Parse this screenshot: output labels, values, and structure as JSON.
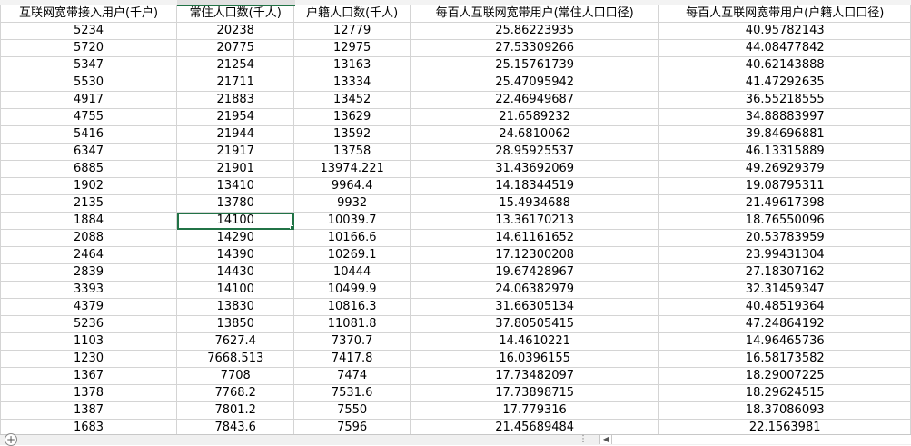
{
  "sheet": {
    "headers": [
      "互联网宽带接入用户(千户)",
      "常住人口数(千人)",
      "户籍人口数(千人)",
      "每百人互联网宽带用户(常住人口口径)",
      "每百人互联网宽带用户(户籍人口口径)"
    ],
    "rows": [
      [
        "5234",
        "20238",
        "12779",
        "25.86223935",
        "40.95782143"
      ],
      [
        "5720",
        "20775",
        "12975",
        "27.53309266",
        "44.08477842"
      ],
      [
        "5347",
        "21254",
        "13163",
        "25.15761739",
        "40.62143888"
      ],
      [
        "5530",
        "21711",
        "13334",
        "25.47095942",
        "41.47292635"
      ],
      [
        "4917",
        "21883",
        "13452",
        "22.46949687",
        "36.55218555"
      ],
      [
        "4755",
        "21954",
        "13629",
        "21.6589232",
        "34.88883997"
      ],
      [
        "5416",
        "21944",
        "13592",
        "24.6810062",
        "39.84696881"
      ],
      [
        "6347",
        "21917",
        "13758",
        "28.95925537",
        "46.13315889"
      ],
      [
        "6885",
        "21901",
        "13974.221",
        "31.43692069",
        "49.26929379"
      ],
      [
        "1902",
        "13410",
        "9964.4",
        "14.18344519",
        "19.08795311"
      ],
      [
        "2135",
        "13780",
        "9932",
        "15.4934688",
        "21.49617398"
      ],
      [
        "1884",
        "14100",
        "10039.7",
        "13.36170213",
        "18.76550096"
      ],
      [
        "2088",
        "14290",
        "10166.6",
        "14.61161652",
        "20.53783959"
      ],
      [
        "2464",
        "14390",
        "10269.1",
        "17.12300208",
        "23.99431304"
      ],
      [
        "2839",
        "14430",
        "10444",
        "19.67428967",
        "27.18307162"
      ],
      [
        "3393",
        "14100",
        "10499.9",
        "24.06382979",
        "32.31459347"
      ],
      [
        "4379",
        "13830",
        "10816.3",
        "31.66305134",
        "40.48519364"
      ],
      [
        "5236",
        "13850",
        "11081.8",
        "37.80505415",
        "47.24864192"
      ],
      [
        "1103",
        "7627.4",
        "7370.7",
        "14.4610221",
        "14.96465736"
      ],
      [
        "1230",
        "7668.513",
        "7417.8",
        "16.0396155",
        "16.58173582"
      ],
      [
        "1367",
        "7708",
        "7474",
        "17.73482097",
        "18.29007225"
      ],
      [
        "1378",
        "7768.2",
        "7531.6",
        "17.73898715",
        "18.29624515"
      ],
      [
        "1387",
        "7801.2",
        "7550",
        "17.779316",
        "18.37086093"
      ],
      [
        "1683",
        "7843.6",
        "7596",
        "21.45689484",
        "22.1563981"
      ]
    ]
  },
  "selection": {
    "row": 11,
    "col": 1
  },
  "bottom_bar": {
    "add_sheet_glyph": "+",
    "tab_menu_glyph": "⋮",
    "scroll_left_glyph": "◀"
  }
}
